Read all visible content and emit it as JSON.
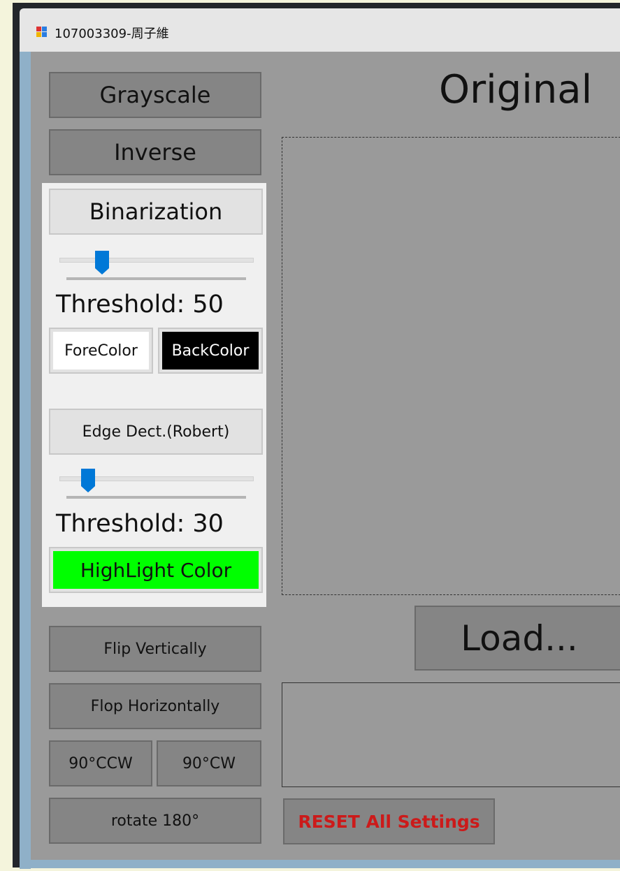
{
  "window": {
    "title": "107003309-周子維"
  },
  "left_panel": {
    "grayscale_label": "Grayscale",
    "inverse_label": "Inverse",
    "binarization": {
      "button_label": "Binarization",
      "slider_value": 50,
      "slider_range": [
        0,
        255
      ],
      "threshold_text": "Threshold: 50",
      "forecolor_label": "ForeColor",
      "backcolor_label": "BackColor",
      "forecolor": "#ffffff",
      "backcolor": "#000000"
    },
    "edge": {
      "button_label": "Edge Dect.(Robert)",
      "slider_value": 30,
      "slider_range": [
        0,
        255
      ],
      "threshold_text": "Threshold: 30",
      "highlight_label": "HighLight Color",
      "highlight_color": "#00ff00"
    },
    "flip_vertical_label": "Flip Vertically",
    "flop_horizontal_label": "Flop Horizontally",
    "rotate_ccw_label": "90°CCW",
    "rotate_cw_label": "90°CW",
    "rotate_180_label": "rotate 180°"
  },
  "main": {
    "heading": "Original",
    "load_label": "Load...",
    "reset_label": "RESET All Settings",
    "reset_color": "#cc1a1a"
  },
  "colors": {
    "client_bg": "#9a9a9a",
    "slider_thumb": "#0078d7"
  }
}
